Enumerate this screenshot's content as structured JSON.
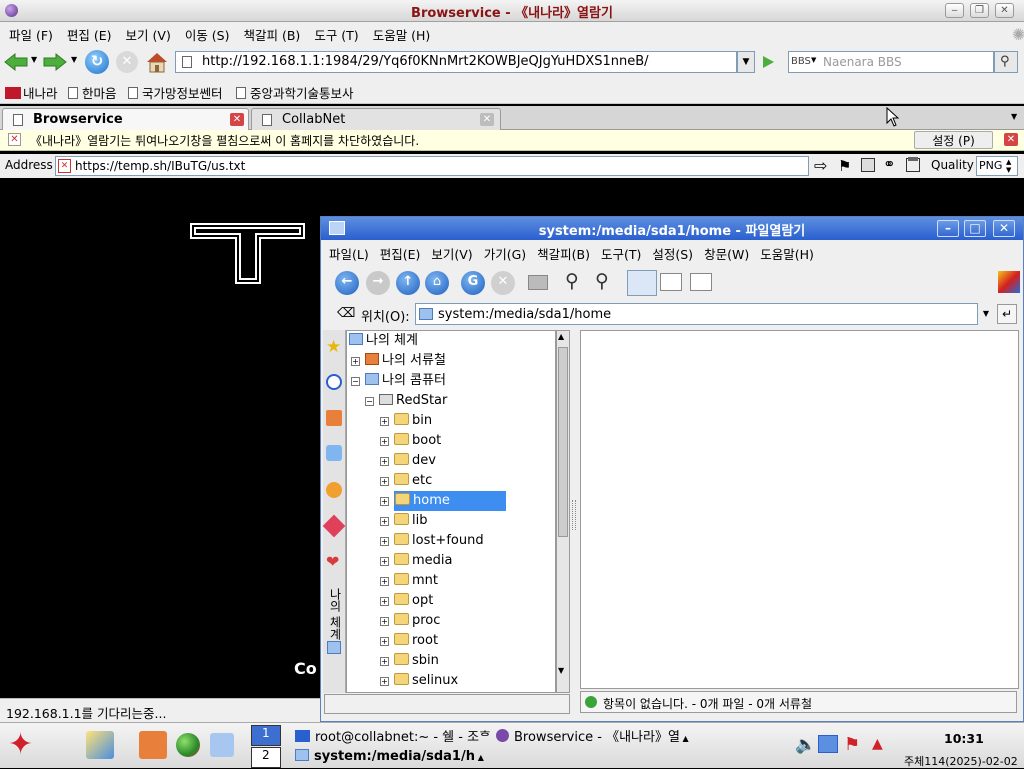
{
  "browser": {
    "window_title": "Browservice - 《내나라》열람기",
    "menu": [
      "파일 (F)",
      "편집 (E)",
      "보기 (V)",
      "이동 (S)",
      "책갈피 (B)",
      "도구 (T)",
      "도움말 (H)"
    ],
    "url": "http://192.168.1.1:1984/29/Yq6f0KNnMrt2KOWBJeQJgYuHDXS1nneB/",
    "search_engine_label": "BBS",
    "search_placeholder": "Naenara BBS",
    "bookmarks": [
      "내나라",
      "한마음",
      "국가망정보쎈터",
      "중앙과학기술통보사"
    ],
    "tabs": [
      {
        "label": "Browservice",
        "active": true
      },
      {
        "label": "CollabNet",
        "active": false
      }
    ],
    "notice_text": "《내나라》열람기는 튀여나오기창을 펼침으로써 이 홈페지를 차단하였습니다.",
    "notice_settings": "설정 (P)",
    "address_label": "Address",
    "address_value": "https://temp.sh/IBuTG/us.txt",
    "quality_label": "Quality",
    "quality_value": "PNG",
    "status_text": "192.168.1.1를 기다리는중...",
    "page_text_fragment": "Co"
  },
  "filemanager": {
    "title": "system:/media/sda1/home - 파일열람기",
    "menu": [
      "파일(L)",
      "편집(E)",
      "보기(V)",
      "가기(G)",
      "책갈피(B)",
      "도구(T)",
      "설정(S)",
      "창문(W)",
      "도움말(H)"
    ],
    "location_label": "위치(O):",
    "location_value": "system:/media/sda1/home",
    "sidebar_tab_label": "나의 체계",
    "tree": [
      {
        "label": "나의 체계",
        "level": 0
      },
      {
        "label": "나의 서류철",
        "level": 0
      },
      {
        "label": "나의 콤퓨터",
        "level": 0
      },
      {
        "label": "RedStar",
        "level": 1
      },
      {
        "label": "bin",
        "level": 2
      },
      {
        "label": "boot",
        "level": 2
      },
      {
        "label": "dev",
        "level": 2
      },
      {
        "label": "etc",
        "level": 2
      },
      {
        "label": "home",
        "level": 2,
        "selected": true
      },
      {
        "label": "lib",
        "level": 2
      },
      {
        "label": "lost+found",
        "level": 2
      },
      {
        "label": "media",
        "level": 2
      },
      {
        "label": "mnt",
        "level": 2
      },
      {
        "label": "opt",
        "level": 2
      },
      {
        "label": "proc",
        "level": 2
      },
      {
        "label": "root",
        "level": 2
      },
      {
        "label": "sbin",
        "level": 2
      },
      {
        "label": "selinux",
        "level": 2
      }
    ],
    "status_text": "항목이 없습니다. - 0개 파일 - 0개 서류철"
  },
  "taskbar": {
    "desktops": [
      "1",
      "2"
    ],
    "tasks": [
      {
        "label": "root@collabnet:~ - 쉘 - 조ᄒ",
        "bold": false
      },
      {
        "label": "Browservice - 《내나라》열",
        "bold": false
      },
      {
        "label": "system:/media/sda1/h",
        "bold": true
      }
    ],
    "clock_time": "10:31",
    "clock_date": "주체114(2025)-02-02"
  },
  "colors": {
    "title_text": "#8a1313",
    "fm_title": "#2a5fcf",
    "selection": "#3d8ef0"
  }
}
